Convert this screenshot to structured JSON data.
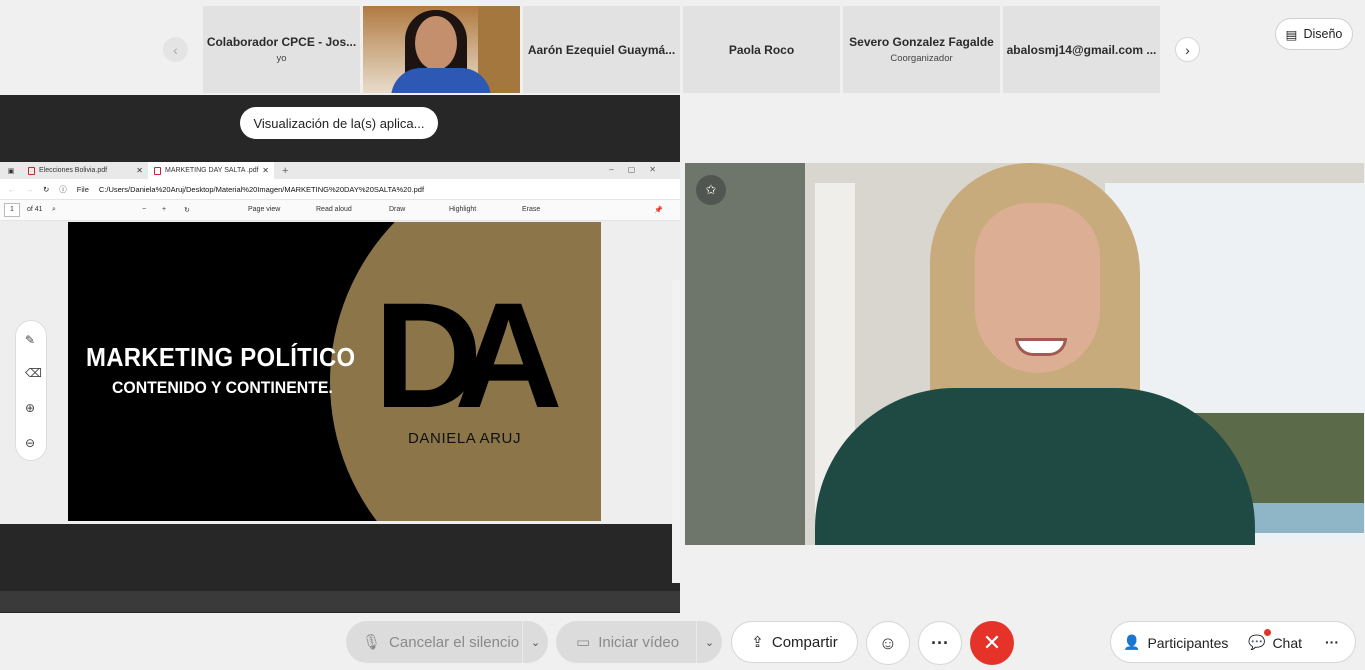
{
  "participants": [
    {
      "name": "Colaborador CPCE - Jos...",
      "sub": "yo"
    },
    {
      "name": "",
      "sub": ""
    },
    {
      "name": "Aarón Ezequiel Guaymá...",
      "sub": ""
    },
    {
      "name": "Paola Roco",
      "sub": ""
    },
    {
      "name": "Severo Gonzalez Fagalde",
      "sub": "Coorganizador"
    },
    {
      "name": "abalosmj14@gmail.com ...",
      "sub": ""
    }
  ],
  "layout_button": "Diseño",
  "share": {
    "pill": "Visualización de la(s) aplica...",
    "tabs": [
      "Elecciones Bolivia.pdf",
      "MARKETING DAY SALTA .pdf"
    ],
    "address_prefix": "File",
    "url": "C:/Users/Daniela%20Aruj/Desktop/Material%20Imagen/MARKETING%20DAY%20SALTA%20.pdf",
    "page_current": "1",
    "page_total": "of 41",
    "toolbar": {
      "page_view": "Page view",
      "read_aloud": "Read aloud",
      "draw": "Draw",
      "highlight": "Highlight",
      "erase": "Erase"
    },
    "slide": {
      "title": "MARKETING POLÍTICO",
      "subtitle": "CONTENIDO Y CONTINENTE.",
      "logo": "DA",
      "author": "DANIELA ARUJ"
    }
  },
  "controls": {
    "mute": "Cancelar el silencio",
    "video": "Iniciar vídeo",
    "share": "Compartir",
    "participants": "Participantes",
    "chat": "Chat"
  },
  "icons": {
    "prev": "chevron-left-icon",
    "next": "chevron-right-icon",
    "layout": "layout-icon",
    "pin": "pin-icon",
    "mic_muted": "mic-muted-icon",
    "camera_off": "camera-off-icon",
    "share": "share-icon",
    "reaction": "smiley-icon",
    "more": "more-icon",
    "end_call": "close-icon",
    "participants": "people-icon",
    "chat": "chat-icon"
  },
  "colors": {
    "end_call": "#e5332a",
    "slide_gold": "#8b7549",
    "share_bg": "#272727"
  }
}
